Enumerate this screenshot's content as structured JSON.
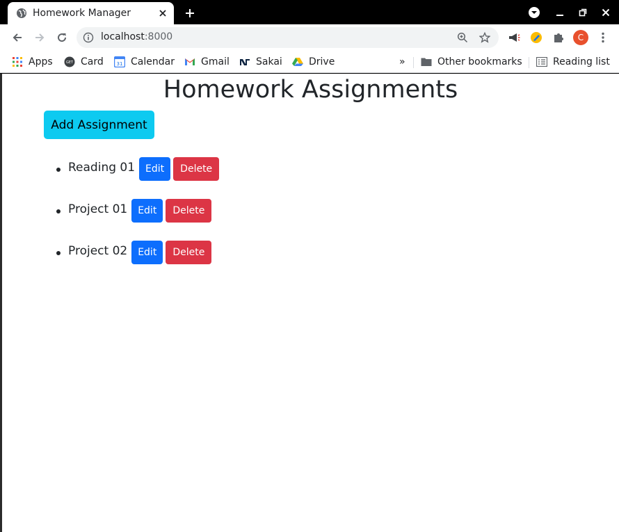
{
  "browser": {
    "tab_title": "Homework Manager",
    "url_host": "localhost",
    "url_port": ":8000",
    "avatar_letter": "C",
    "colors": {
      "tab_strip": "#000000",
      "omnibox": "#f1f3f4",
      "avatar": "#e8502d"
    }
  },
  "bookmarks": {
    "items": [
      {
        "label": "Apps",
        "icon": "apps-grid-icon"
      },
      {
        "label": "Card",
        "icon": "get-card-icon"
      },
      {
        "label": "Calendar",
        "icon": "calendar-icon"
      },
      {
        "label": "Gmail",
        "icon": "gmail-icon"
      },
      {
        "label": "Sakai",
        "icon": "notre-dame-icon"
      },
      {
        "label": "Drive",
        "icon": "drive-icon"
      }
    ],
    "overflow": "»",
    "other_bookmarks": "Other bookmarks",
    "reading_list": "Reading list"
  },
  "page": {
    "title": "Homework Assignments",
    "add_button": "Add Assignment",
    "assignments": [
      {
        "name": "Reading 01",
        "edit_label": "Edit",
        "delete_label": "Delete"
      },
      {
        "name": "Project 01",
        "edit_label": "Edit",
        "delete_label": "Delete"
      },
      {
        "name": "Project 02",
        "edit_label": "Edit",
        "delete_label": "Delete"
      }
    ],
    "colors": {
      "add": "#0dcaf0",
      "edit": "#0d6efd",
      "delete": "#dc3545",
      "text": "#212529"
    }
  }
}
